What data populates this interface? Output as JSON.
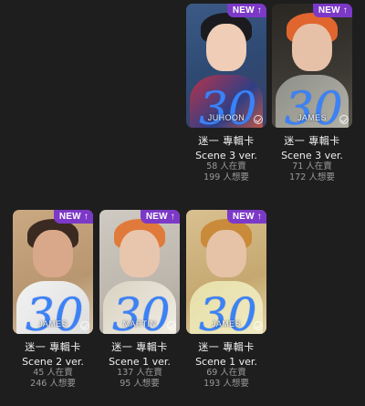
{
  "cards": [
    {
      "id": "junhoon",
      "badge": "NEW ↑",
      "member_overlay": "JUHOON",
      "scribble": "30",
      "title": "迷一 專輯卡",
      "version": "Scene 3 ver.",
      "selling": "58 人在賣",
      "wanting": "199 人想要"
    },
    {
      "id": "james-1",
      "badge": "NEW ↑",
      "member_overlay": "JAMES",
      "scribble": "30",
      "title": "迷一 專輯卡",
      "version": "Scene 3 ver.",
      "selling": "71 人在賣",
      "wanting": "172 人想要"
    },
    {
      "id": "james-2",
      "badge": "NEW ↑",
      "member_overlay": "JAMES",
      "scribble": "30",
      "title": "迷一 專輯卡",
      "version": "Scene 2 ver.",
      "selling": "45 人在賣",
      "wanting": "246 人想要"
    },
    {
      "id": "martin",
      "badge": "NEW ↑",
      "member_overlay": "MARTIN",
      "scribble": "30",
      "title": "迷一 專輯卡",
      "version": "Scene 1 ver.",
      "selling": "137 人在賣",
      "wanting": "95 人想要"
    },
    {
      "id": "james-3",
      "badge": "NEW ↑",
      "member_overlay": "JAMES",
      "scribble": "30",
      "title": "迷一 專輯卡",
      "version": "Scene 1 ver.",
      "selling": "69 人在賣",
      "wanting": "193 人想要"
    }
  ],
  "colors": {
    "background": "#1e1e1f",
    "badge": "#7c39c7",
    "scribble": "#3b82f6",
    "stat_text": "#9a9a9c"
  },
  "icons": {
    "selected": "check-circle-icon",
    "badge_arrow": "arrow-up-icon"
  }
}
